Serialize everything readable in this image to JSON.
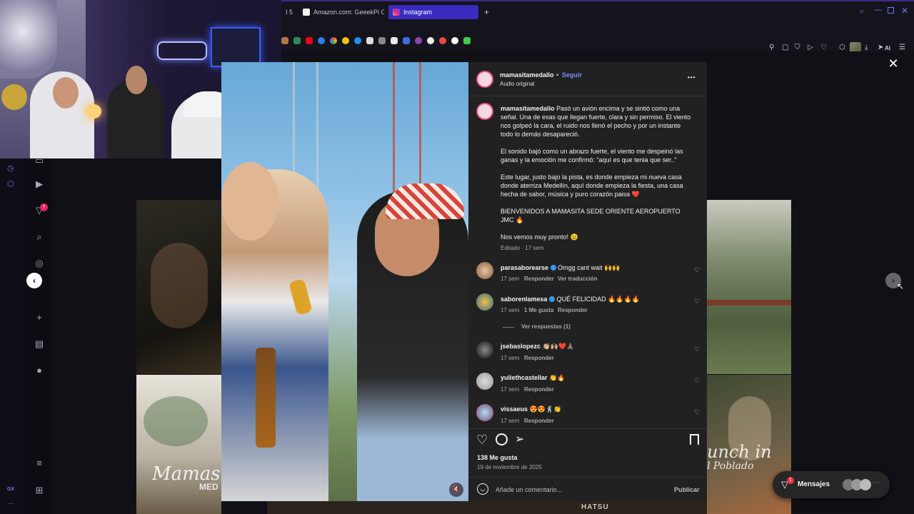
{
  "browser": {
    "tabs": [
      {
        "label": "I 5"
      },
      {
        "label": "Amazon.com: GeeekPi Ori"
      },
      {
        "label": "Instagram"
      }
    ],
    "new_tab_symbol": "+",
    "ai_label": "AI",
    "icons": [
      "search-icon",
      "minimize-icon",
      "restore-icon",
      "close-window-icon",
      "pin-icon",
      "screenshot-icon",
      "shield-icon",
      "play-icon",
      "heart-icon",
      "extensions-icon",
      "download-icon",
      "send-icon",
      "menu-icon"
    ]
  },
  "sidebar": {
    "badge_count": "7",
    "bottom_label": "GX"
  },
  "post": {
    "username": "mamasitamedallo",
    "follow_label": "Seguir",
    "dot": "•",
    "audio": "Audio original",
    "more_symbol": "•••",
    "caption_paragraphs": [
      "Pasó un avión encima y se sintió como una señal. Una de esas que llegan fuerte, clara y sin permiso. El viento nos golpeó la cara, el ruido nos llenó el pecho y por un instante todo lo demás desapareció.",
      "El sonido bajó como un abrazo fuerte, el viento me despeinó las ganas y la emoción me confirmó: “aquí es que tenia que ser..”",
      "Este lugar, justo bajo la pista, es donde empieza mi nueva casa donde aterriza Medellín, aquí donde empieza la fiesta, una casa hecha de sabor, música y puro corazón paisa ❤️",
      "BIENVENIDOS A MAMASITA SEDE ORIENTE AEROPUERTO JMC 🔥",
      "Nos vemos muy pronto! 😉"
    ],
    "caption_meta": "Editado · 17 sem",
    "comments": [
      {
        "user": "parasaborearse",
        "text": "Omgg cant wait 🙌🙌",
        "time": "17 sem",
        "likes": "",
        "reply": "Responder",
        "translate": "Ver traducción",
        "verified": true
      },
      {
        "user": "saborenlamesa",
        "text": "QUÉ FELICIDAD 🔥🔥🔥🔥",
        "time": "17 sem",
        "likes": "1 Me gusta",
        "reply": "Responder",
        "translate": "",
        "verified": true
      },
      {
        "user": "jsebaslopezc",
        "text": "👏🏼🙌🏼❤️🙏🏽",
        "time": "17 sem",
        "likes": "",
        "reply": "Responder",
        "translate": "",
        "verified": false
      },
      {
        "user": "yuliethcastellar",
        "text": "👏🔥",
        "time": "17 sem",
        "likes": "",
        "reply": "Responder",
        "translate": "",
        "verified": false
      },
      {
        "user": "vissaeus",
        "text": "😍😍🕺👏",
        "time": "17 sem",
        "likes": "",
        "reply": "Responder",
        "translate": "",
        "verified": false
      }
    ],
    "view_replies": "Ver respuestas (1)",
    "likes_count": "138 Me gusta",
    "date": "19 de noviembre de 2025",
    "comment_placeholder": "Añade un comentario...",
    "publish_label": "Publicar"
  },
  "backdrop": {
    "left_script": "Mamas",
    "left_script_sub": "MED",
    "right_script": "unch in",
    "right_script_sub": "l Poblado",
    "bottom_text": "HATSU"
  },
  "messages": {
    "label": "Mensajes",
    "badge": "1"
  },
  "colors": {
    "accent": "#3a2bbf",
    "follow": "#7b8cff",
    "panel": "#212121",
    "verified": "#3897f0"
  }
}
